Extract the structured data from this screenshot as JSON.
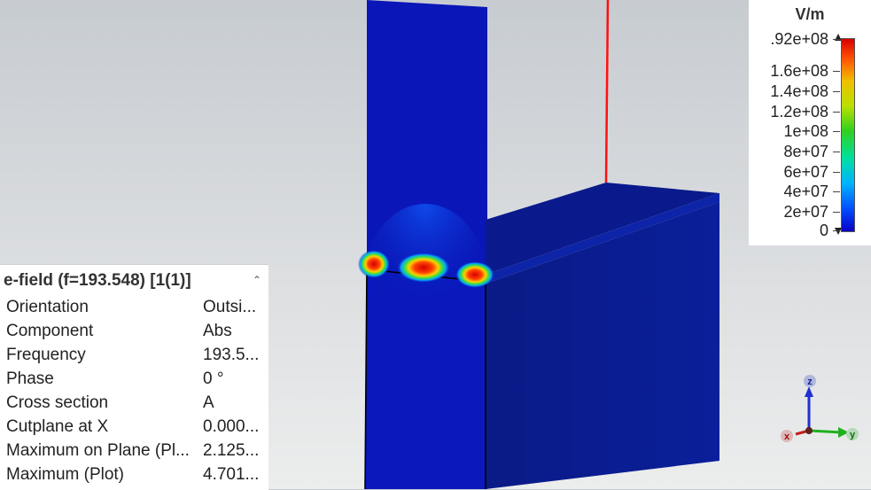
{
  "legend": {
    "unit": "V/m",
    "ticks": [
      ".92e+08",
      "1.6e+08",
      "1.4e+08",
      "1.2e+08",
      "1e+08",
      "8e+07",
      "6e+07",
      "4e+07",
      "2e+07",
      "0"
    ],
    "colors": {
      "max": "#d80000",
      "min": "#0a00c8"
    }
  },
  "panel": {
    "title": "e-field (f=193.548) [1(1)]",
    "rows": [
      {
        "key": "Orientation",
        "value": "Outsi..."
      },
      {
        "key": "Component",
        "value": "Abs"
      },
      {
        "key": "Frequency",
        "value": "193.5..."
      },
      {
        "key": "Phase",
        "value": "0 °"
      },
      {
        "key": "Cross section",
        "value": "A"
      },
      {
        "key": "Cutplane at X",
        "value": "0.000..."
      },
      {
        "key": "Maximum on Plane (Pl...",
        "value": "2.125..."
      },
      {
        "key": "Maximum (Plot)",
        "value": "4.701..."
      }
    ]
  },
  "axes": {
    "z": "z",
    "y": "y",
    "x": "x"
  },
  "colors": {
    "field_blue": "#0a14b4",
    "block_top": "#0a1a8a",
    "source_line": "#ff1010"
  }
}
